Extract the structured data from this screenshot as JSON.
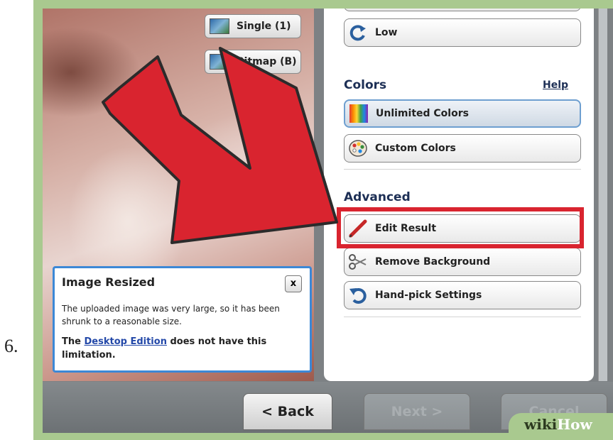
{
  "step_number": "6.",
  "image_options": {
    "single_label": "Single (1)",
    "bitmap_label": "Bitmap (B)"
  },
  "settings": {
    "low_label": "Low",
    "colors_heading": "Colors",
    "help_link": "Help",
    "unlimited_colors_label": "Unlimited Colors",
    "custom_colors_label": "Custom Colors",
    "advanced_heading": "Advanced",
    "edit_result_label": "Edit Result",
    "remove_background_label": "Remove Background",
    "hand_pick_settings_label": "Hand-pick Settings"
  },
  "popup": {
    "title": "Image Resized",
    "close_label": "x",
    "body": "The uploaded image was very large, so it has been shrunk to a reasonable size.",
    "note_prefix": "The",
    "note_link": "Desktop Edition",
    "note_suffix": "does not have this limitation."
  },
  "footer": {
    "back_label": "< Back",
    "next_label": "Next >",
    "cancel_label": "Cancel"
  },
  "watermark": {
    "wiki": "wiki",
    "how": "How"
  },
  "colors": {
    "highlight_box": "#d9242f",
    "arrow_fill": "#d9242f",
    "heading_text": "#1d2f55",
    "selected_border": "#6e9fd0",
    "popup_border": "#3c88d6",
    "frame_green": "#a9c98f"
  },
  "icons": [
    "image-icon",
    "refresh-icon",
    "color-spectrum-icon",
    "palette-icon",
    "pencil-icon",
    "scissors-icon",
    "undo-arrow-icon",
    "close-icon"
  ]
}
